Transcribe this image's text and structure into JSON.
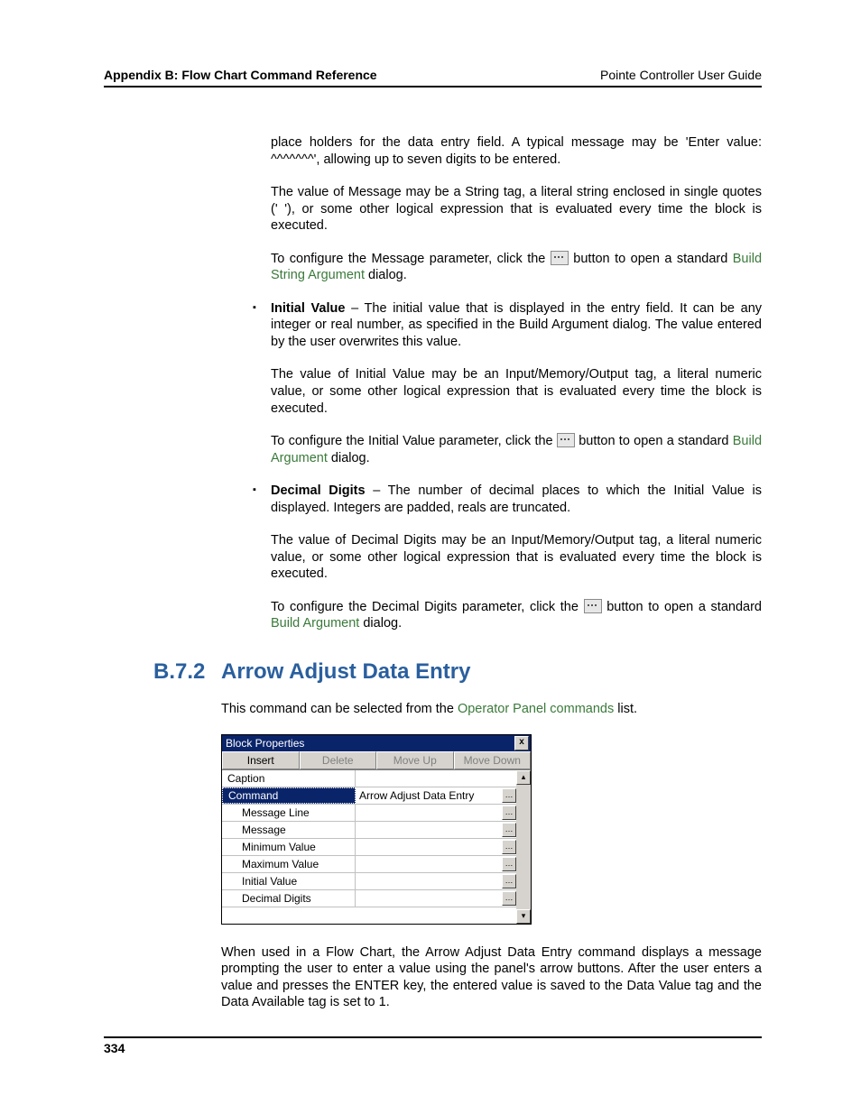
{
  "header": {
    "left": "Appendix B: Flow Chart Command Reference",
    "right": "Pointe Controller User Guide"
  },
  "intro": {
    "p1": "place holders for the data entry field. A typical message may be 'Enter value: ^^^^^^^', allowing up to seven digits to be entered.",
    "p2": "The value of Message may be a String tag, a literal string enclosed in single quotes (' '), or some other logical expression that is evaluated every time the block is executed.",
    "p3a": "To configure the Message parameter, click the ",
    "p3b": " button to open a standard ",
    "p3c": " dialog.",
    "link1": "Build String Argument"
  },
  "bullets": {
    "iv": {
      "head": "Initial Value",
      "p1": " – The initial value that is displayed in the entry field. It can be any integer or real number, as specified in the Build Argument dialog. The value entered by the user overwrites this value.",
      "p2": "The value of Initial Value may be an Input/Memory/Output tag, a literal numeric value, or some other logical expression that is evaluated every time the block is executed.",
      "p3a": "To configure the Initial Value parameter, click the ",
      "p3b": " button to open a standard ",
      "p3c": " dialog.",
      "link": "Build Argument"
    },
    "dd": {
      "head": "Decimal Digits",
      "p1": " – The number of decimal places to which the Initial Value is displayed. Integers are padded, reals are truncated.",
      "p2": "The value of Decimal Digits may be an Input/Memory/Output tag, a literal numeric value, or some other logical expression that is evaluated every time the block is executed.",
      "p3a": "To configure the Decimal Digits parameter, click the ",
      "p3b": " button to open a standard ",
      "p3c": " dialog.",
      "link": "Build Argument"
    }
  },
  "section": {
    "num": "B.7.2",
    "title": "Arrow Adjust Data Entry",
    "intro_a": "This command can be selected from the ",
    "intro_link": "Operator Panel commands",
    "intro_b": " list.",
    "outro": "When used in a Flow Chart, the Arrow Adjust Data Entry command displays a message prompting the user to enter a value using the panel's arrow buttons. After the user enters a value and presses the ENTER key, the entered value is saved to the Data Value tag and the Data Available tag is set to 1."
  },
  "dialog": {
    "title": "Block Properties",
    "close": "x",
    "buttons": {
      "insert": "Insert",
      "delete": "Delete",
      "moveup": "Move Up",
      "movedown": "Move Down"
    },
    "rows": {
      "caption": "Caption",
      "command": "Command",
      "command_val": "Arrow Adjust Data Entry",
      "msgline": "Message Line",
      "msg": "Message",
      "min": "Minimum Value",
      "max": "Maximum Value",
      "iv": "Initial Value",
      "dd": "Decimal Digits"
    },
    "ellipsis": "…",
    "up": "▴",
    "down": "▾"
  },
  "footer": "334"
}
